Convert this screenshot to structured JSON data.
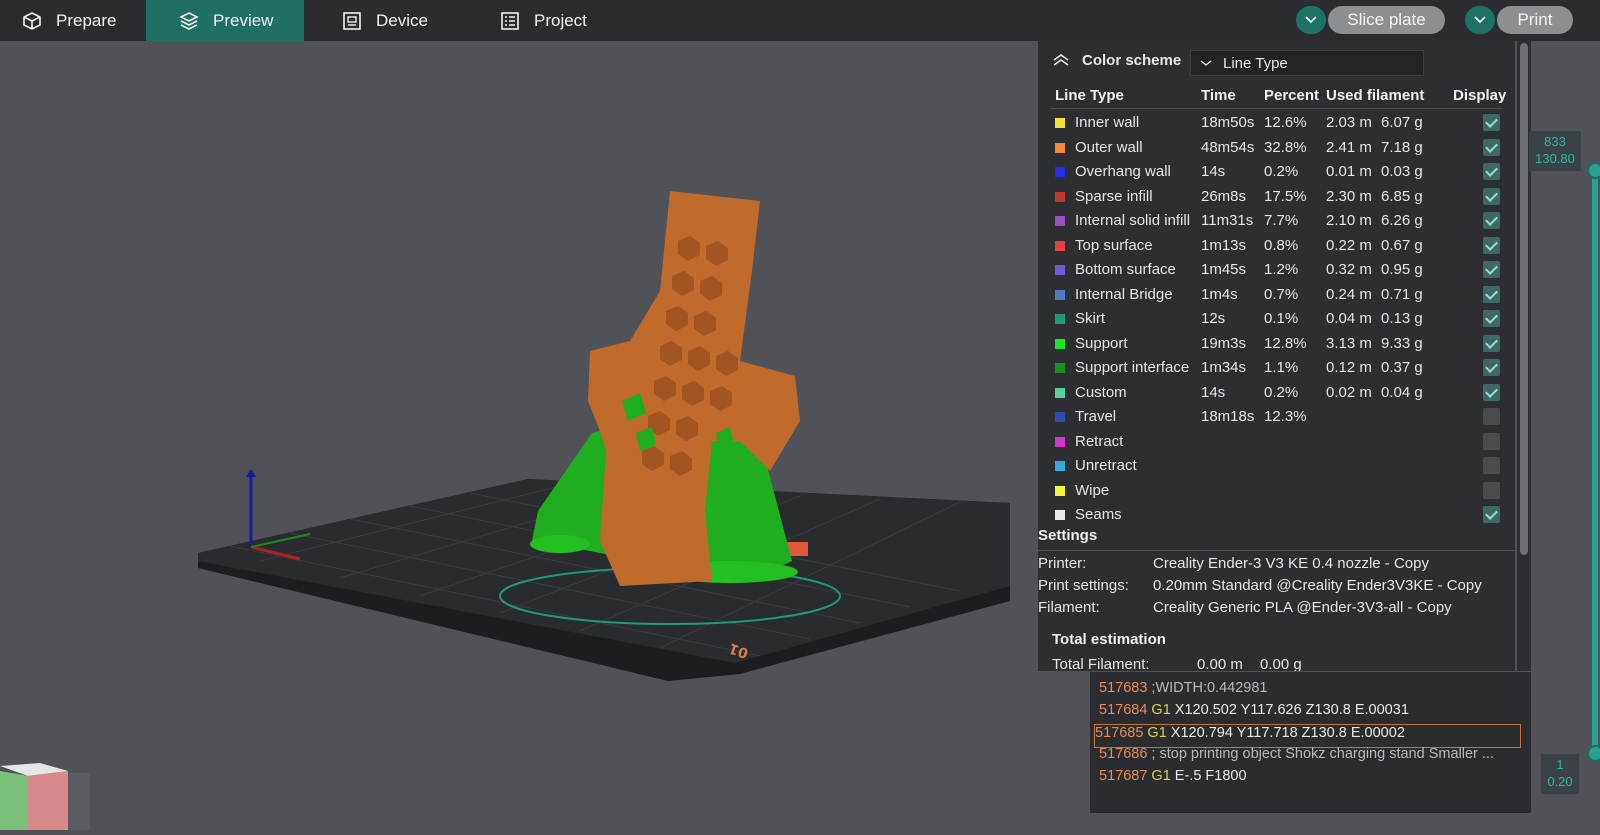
{
  "topbar": {
    "tabs": [
      {
        "label": "Prepare",
        "icon": "box-icon"
      },
      {
        "label": "Preview",
        "icon": "layers-icon"
      },
      {
        "label": "Device",
        "icon": "monitor-icon"
      },
      {
        "label": "Project",
        "icon": "list-icon"
      }
    ],
    "active_tab": "Preview",
    "slice_label": "Slice plate",
    "print_label": "Print"
  },
  "legend": {
    "title": "Color scheme",
    "scheme_value": "Line Type",
    "headers": {
      "type": "Line Type",
      "time": "Time",
      "percent": "Percent",
      "filament": "Used filament",
      "display": "Display"
    },
    "rows": [
      {
        "name": "Inner wall",
        "color": "#f5e03a",
        "time": "18m50s",
        "percent": "12.6%",
        "length": "2.03 m",
        "weight": "6.07 g",
        "display": true
      },
      {
        "name": "Outer wall",
        "color": "#f08a3a",
        "time": "48m54s",
        "percent": "32.8%",
        "length": "2.41 m",
        "weight": "7.18 g",
        "display": true
      },
      {
        "name": "Overhang wall",
        "color": "#2230ee",
        "time": "14s",
        "percent": "0.2%",
        "length": "0.01 m",
        "weight": "0.03 g",
        "display": true
      },
      {
        "name": "Sparse infill",
        "color": "#c0392b",
        "time": "26m8s",
        "percent": "17.5%",
        "length": "2.30 m",
        "weight": "6.85 g",
        "display": true
      },
      {
        "name": "Internal solid infill",
        "color": "#9b4fc6",
        "time": "11m31s",
        "percent": "7.7%",
        "length": "2.10 m",
        "weight": "6.26 g",
        "display": true
      },
      {
        "name": "Top surface",
        "color": "#e84040",
        "time": "1m13s",
        "percent": "0.8%",
        "length": "0.22 m",
        "weight": "0.67 g",
        "display": true
      },
      {
        "name": "Bottom surface",
        "color": "#6a5bd6",
        "time": "1m45s",
        "percent": "1.2%",
        "length": "0.32 m",
        "weight": "0.95 g",
        "display": true
      },
      {
        "name": "Internal Bridge",
        "color": "#4f7ac6",
        "time": "1m4s",
        "percent": "0.7%",
        "length": "0.24 m",
        "weight": "0.71 g",
        "display": true
      },
      {
        "name": "Skirt",
        "color": "#1f9a7a",
        "time": "12s",
        "percent": "0.1%",
        "length": "0.04 m",
        "weight": "0.13 g",
        "display": true
      },
      {
        "name": "Support",
        "color": "#22e022",
        "time": "19m3s",
        "percent": "12.8%",
        "length": "3.13 m",
        "weight": "9.33 g",
        "display": true
      },
      {
        "name": "Support interface",
        "color": "#1c8f1c",
        "time": "1m34s",
        "percent": "1.1%",
        "length": "0.12 m",
        "weight": "0.37 g",
        "display": true
      },
      {
        "name": "Custom",
        "color": "#4fd39a",
        "time": "14s",
        "percent": "0.2%",
        "length": "0.02 m",
        "weight": "0.04 g",
        "display": true
      },
      {
        "name": "Travel",
        "color": "#2f4ab0",
        "time": "18m18s",
        "percent": "12.3%",
        "length": "",
        "weight": "",
        "display": false
      },
      {
        "name": "Retract",
        "color": "#d236d2",
        "time": "",
        "percent": "",
        "length": "",
        "weight": "",
        "display": false
      },
      {
        "name": "Unretract",
        "color": "#3aa6e0",
        "time": "",
        "percent": "",
        "length": "",
        "weight": "",
        "display": false
      },
      {
        "name": "Wipe",
        "color": "#f2f23a",
        "time": "",
        "percent": "",
        "length": "",
        "weight": "",
        "display": false
      },
      {
        "name": "Seams",
        "color": "#e8e8e8",
        "time": "",
        "percent": "",
        "length": "",
        "weight": "",
        "display": true
      }
    ],
    "settings": {
      "title": "Settings",
      "printer_label": "Printer:",
      "printer_value": "Creality Ender-3 V3 KE 0.4 nozzle - Copy",
      "print_settings_label": "Print settings:",
      "print_settings_value": "0.20mm Standard @Creality Ender3V3KE - Copy",
      "filament_label": "Filament:",
      "filament_value": "Creality Generic PLA @Ender-3V3-all - Copy"
    },
    "total": {
      "title": "Total estimation",
      "filament_label": "Total Filament:",
      "filament_length": "0.00 m",
      "filament_weight": "0.00 g"
    }
  },
  "gcode": [
    {
      "line": "517683",
      "cmd": "",
      "text": ";WIDTH:0.442981",
      "comment": true
    },
    {
      "line": "517684",
      "cmd": "G1",
      "text": "X120.502 Y117.626 Z130.8 E.00031",
      "comment": false
    },
    {
      "line": "517685",
      "cmd": "G1",
      "text": "X120.794 Y117.718 Z130.8 E.00002",
      "comment": false
    },
    {
      "line": "517686",
      "cmd": "",
      "text": "; stop printing object Shokz charging stand Smaller ...",
      "comment": true
    },
    {
      "line": "517687",
      "cmd": "G1",
      "text": "E-.5 F1800",
      "comment": false
    }
  ],
  "gcode_selected_index": 2,
  "layer_slider": {
    "top_layer": "833",
    "top_height": "130.80",
    "bottom_layer": "1",
    "bottom_height": "0.20"
  },
  "plate_number": "01",
  "colors": {
    "accent": "#1f6f63",
    "model": "#c06a2c",
    "support": "#1fae1f"
  }
}
